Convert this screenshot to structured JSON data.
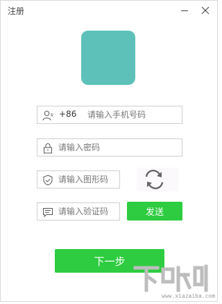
{
  "window": {
    "title": "注册",
    "minimize_icon": "minimize-icon",
    "close_icon": "close-icon"
  },
  "avatar": {
    "color": "#5ec1b9"
  },
  "form": {
    "phone": {
      "prefix": "+86",
      "placeholder": "请输入手机号码",
      "icon": "user-icon"
    },
    "password": {
      "placeholder": "请输入密码",
      "icon": "lock-icon"
    },
    "captcha": {
      "placeholder": "请输入图形码",
      "icon": "shield-icon",
      "refresh_icon": "refresh-icon"
    },
    "sms_code": {
      "placeholder": "请输入验证码",
      "icon": "message-icon"
    },
    "send_button": "发送",
    "next_button": "下一步"
  },
  "colors": {
    "accent": "#2ecc40",
    "border": "#cfcfcf"
  },
  "watermark": {
    "logo_text": "下载吧",
    "url_text": "www.xiazaiba.com"
  }
}
